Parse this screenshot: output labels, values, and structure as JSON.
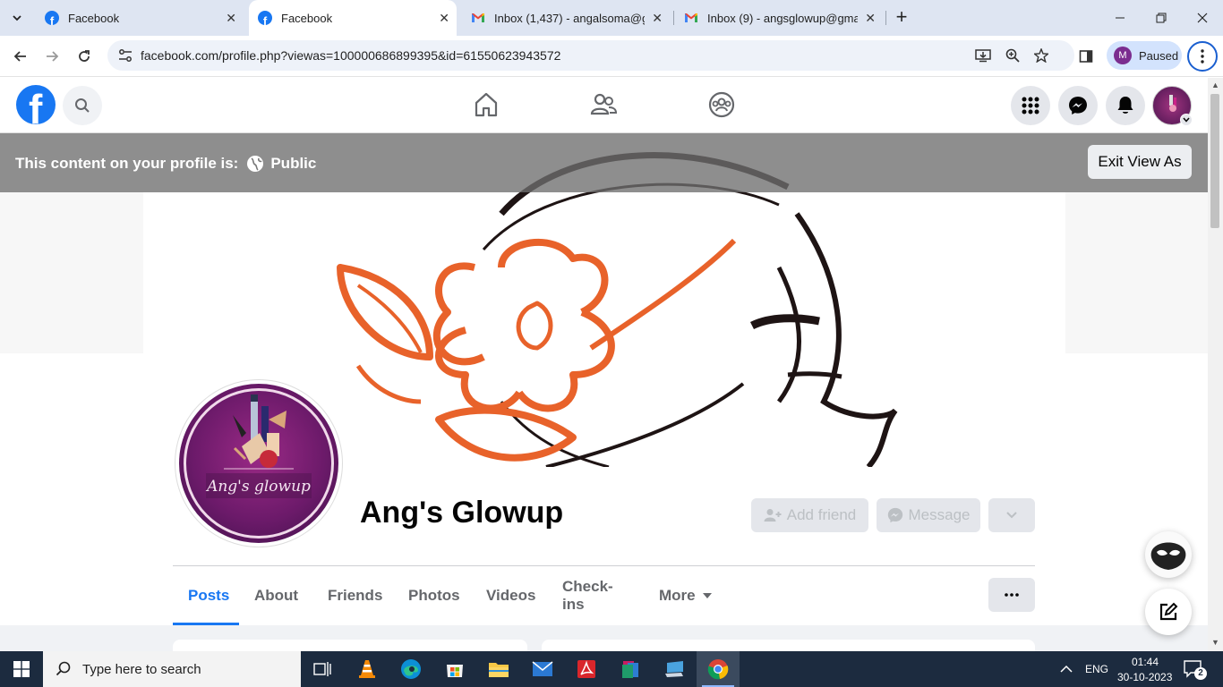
{
  "browser": {
    "tabs": [
      {
        "title": "Facebook",
        "icon": "facebook-icon"
      },
      {
        "title": "Facebook",
        "icon": "facebook-icon",
        "active": true
      },
      {
        "title": "Inbox (1,437) - angalsoma@gm",
        "icon": "gmail-icon"
      },
      {
        "title": "Inbox (9) - angsglowup@gmai",
        "icon": "gmail-icon"
      }
    ],
    "new_tab": "+",
    "url": "facebook.com/profile.php?viewas=100000686899395&id=61550623943572",
    "profile_initial": "M",
    "profile_status": "Paused"
  },
  "viewas": {
    "label": "This content on your profile is:",
    "audience": "Public",
    "exit_label": "Exit View As"
  },
  "profile": {
    "name": "Ang's Glowup",
    "avatar_text": "Ang's glowup",
    "add_friend": "Add friend",
    "message": "Message"
  },
  "profile_tabs": [
    "Posts",
    "About",
    "Friends",
    "Photos",
    "Videos",
    "Check-ins",
    "More"
  ],
  "taskbar": {
    "search_placeholder": "Type here to search",
    "lang": "ENG",
    "time": "01:44",
    "date": "30-10-2023",
    "notification_count": "2"
  },
  "colors": {
    "facebook_blue": "#1877f2",
    "cover_orange": "#e8622a",
    "avatar_purple": "#7a1f70"
  }
}
